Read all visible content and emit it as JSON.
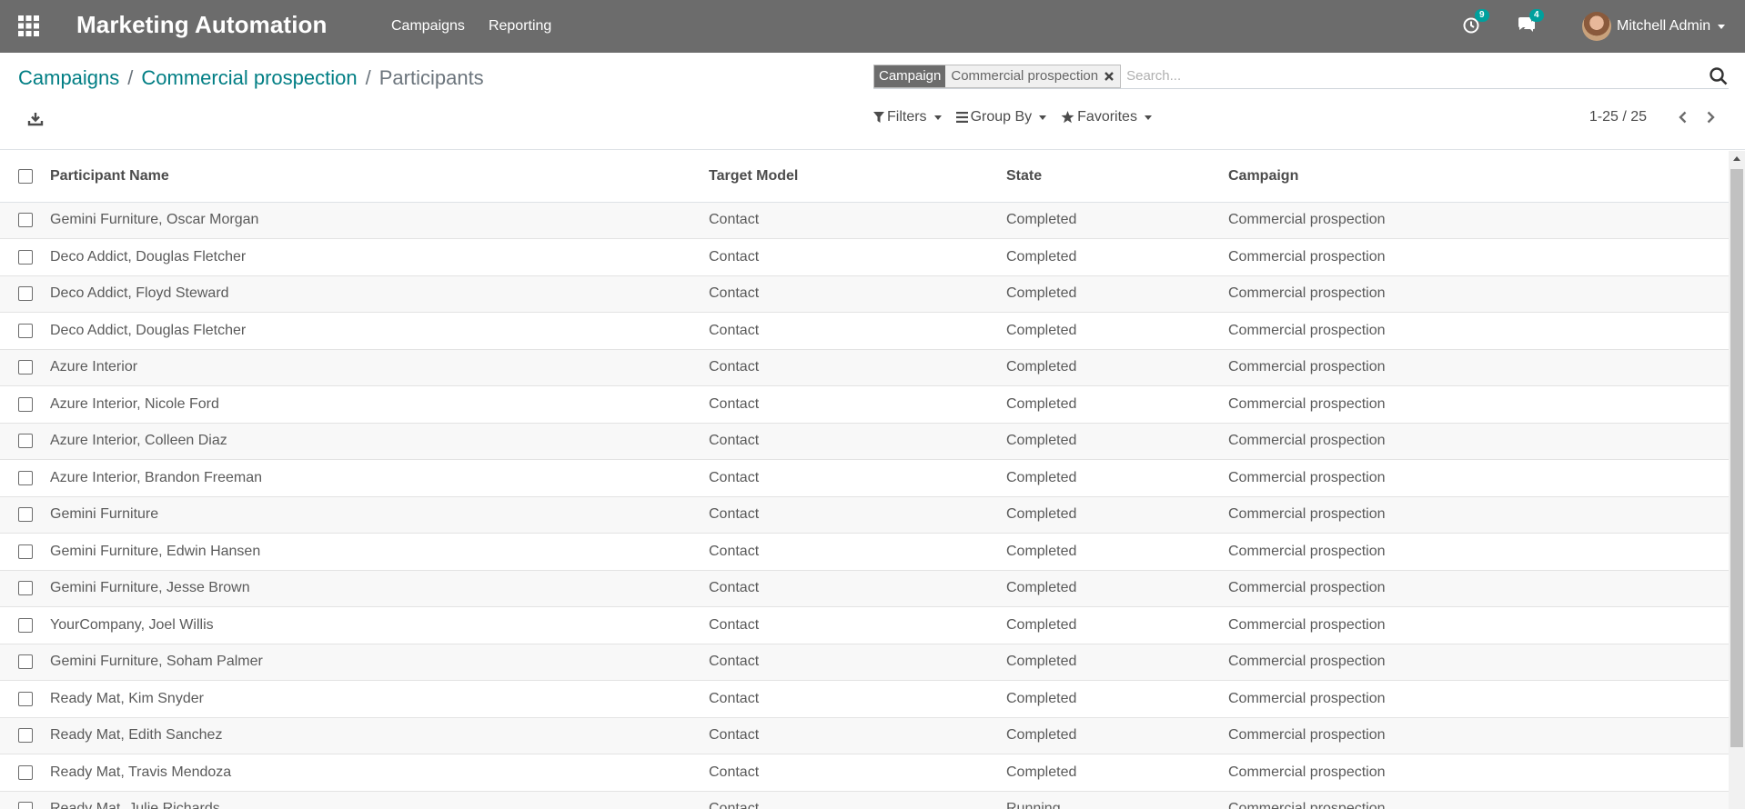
{
  "navbar": {
    "app_title": "Marketing Automation",
    "menu": [
      {
        "label": "Campaigns"
      },
      {
        "label": "Reporting"
      }
    ],
    "activity_count": "9",
    "messages_count": "4",
    "user_name": "Mitchell Admin"
  },
  "breadcrumb": {
    "items": [
      {
        "label": "Campaigns"
      },
      {
        "label": "Commercial prospection"
      }
    ],
    "current": "Participants",
    "separator": "/"
  },
  "search": {
    "facet_label": "Campaign",
    "facet_value": "Commercial prospection",
    "placeholder": "Search..."
  },
  "toolbar": {
    "filters_label": "Filters",
    "group_by_label": "Group By",
    "favorites_label": "Favorites",
    "pager_value": "1-25 / 25"
  },
  "table": {
    "columns": [
      "Participant Name",
      "Target Model",
      "State",
      "Campaign"
    ],
    "rows": [
      {
        "name": "Gemini Furniture, Oscar Morgan",
        "model": "Contact",
        "state": "Completed",
        "campaign": "Commercial prospection"
      },
      {
        "name": "Deco Addict, Douglas Fletcher",
        "model": "Contact",
        "state": "Completed",
        "campaign": "Commercial prospection"
      },
      {
        "name": "Deco Addict, Floyd Steward",
        "model": "Contact",
        "state": "Completed",
        "campaign": "Commercial prospection"
      },
      {
        "name": "Deco Addict, Douglas Fletcher",
        "model": "Contact",
        "state": "Completed",
        "campaign": "Commercial prospection"
      },
      {
        "name": "Azure Interior",
        "model": "Contact",
        "state": "Completed",
        "campaign": "Commercial prospection"
      },
      {
        "name": "Azure Interior, Nicole Ford",
        "model": "Contact",
        "state": "Completed",
        "campaign": "Commercial prospection"
      },
      {
        "name": "Azure Interior, Colleen Diaz",
        "model": "Contact",
        "state": "Completed",
        "campaign": "Commercial prospection"
      },
      {
        "name": "Azure Interior, Brandon Freeman",
        "model": "Contact",
        "state": "Completed",
        "campaign": "Commercial prospection"
      },
      {
        "name": "Gemini Furniture",
        "model": "Contact",
        "state": "Completed",
        "campaign": "Commercial prospection"
      },
      {
        "name": "Gemini Furniture, Edwin Hansen",
        "model": "Contact",
        "state": "Completed",
        "campaign": "Commercial prospection"
      },
      {
        "name": "Gemini Furniture, Jesse Brown",
        "model": "Contact",
        "state": "Completed",
        "campaign": "Commercial prospection"
      },
      {
        "name": "YourCompany, Joel Willis",
        "model": "Contact",
        "state": "Completed",
        "campaign": "Commercial prospection"
      },
      {
        "name": "Gemini Furniture, Soham Palmer",
        "model": "Contact",
        "state": "Completed",
        "campaign": "Commercial prospection"
      },
      {
        "name": "Ready Mat, Kim Snyder",
        "model": "Contact",
        "state": "Completed",
        "campaign": "Commercial prospection"
      },
      {
        "name": "Ready Mat, Edith Sanchez",
        "model": "Contact",
        "state": "Completed",
        "campaign": "Commercial prospection"
      },
      {
        "name": "Ready Mat, Travis Mendoza",
        "model": "Contact",
        "state": "Completed",
        "campaign": "Commercial prospection"
      },
      {
        "name": "Ready Mat, Julie Richards",
        "model": "Contact",
        "state": "Running",
        "campaign": "Commercial prospection"
      }
    ]
  },
  "colors": {
    "navbar_bg": "#6c6c6c",
    "link": "#017e84",
    "badge": "#00a09d"
  }
}
